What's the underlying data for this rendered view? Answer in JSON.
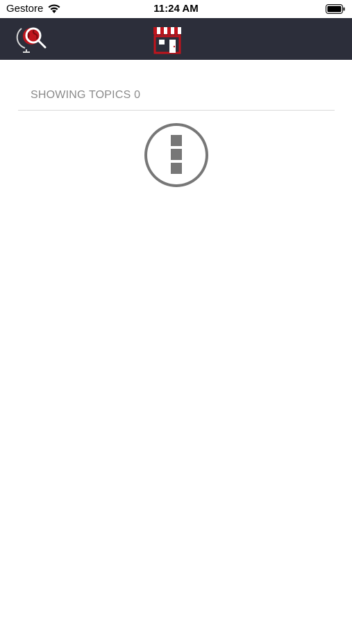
{
  "status_bar": {
    "carrier": "Gestore",
    "time": "11:24 AM"
  },
  "nav_bar": {
    "left_icon": "search-globe-icon",
    "center_icon": "store-icon",
    "background_color": "#2c2e3a",
    "accent_color": "#c0141c"
  },
  "topics": {
    "label": "SHOWING TOPICS 0"
  },
  "empty_state": {
    "icon": "more-vertical-circle-icon"
  }
}
